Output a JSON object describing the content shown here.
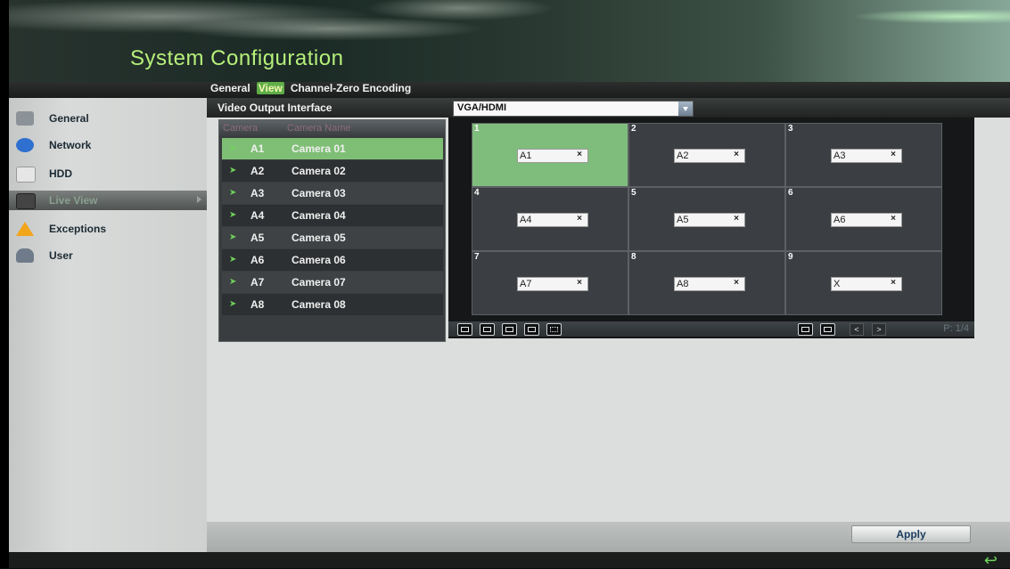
{
  "header": {
    "title": "System Configuration"
  },
  "tabs": [
    {
      "label": "General"
    },
    {
      "label": "View",
      "active": true
    },
    {
      "label": "Channel-Zero Encoding"
    }
  ],
  "sidebar": {
    "items": [
      {
        "label": "General",
        "icon": "gear-icon",
        "color": "#8c9398"
      },
      {
        "label": "Network",
        "icon": "globe-icon",
        "color": "#2f6fd0"
      },
      {
        "label": "HDD",
        "icon": "hdd-icon",
        "color": "#e6e6e6"
      },
      {
        "label": "Live View",
        "icon": "monitor-icon",
        "color": "#444444",
        "active": true
      },
      {
        "label": "Exceptions",
        "icon": "warning-icon",
        "color": "#f2a51a"
      },
      {
        "label": "User",
        "icon": "user-icon",
        "color": "#6f7b8a"
      }
    ]
  },
  "video_output": {
    "label": "Video Output Interface",
    "value": "VGA/HDMI"
  },
  "camera_list": {
    "headers": {
      "camera": "Camera",
      "name": "Camera Name"
    },
    "rows": [
      {
        "no": "A1",
        "name": "Camera 01",
        "selected": true
      },
      {
        "no": "A2",
        "name": "Camera 02"
      },
      {
        "no": "A3",
        "name": "Camera 03"
      },
      {
        "no": "A4",
        "name": "Camera 04"
      },
      {
        "no": "A5",
        "name": "Camera 05"
      },
      {
        "no": "A6",
        "name": "Camera 06"
      },
      {
        "no": "A7",
        "name": "Camera 07"
      },
      {
        "no": "A8",
        "name": "Camera 08"
      }
    ]
  },
  "preview": {
    "panes": [
      {
        "num": "1",
        "tag": "A1",
        "selected": true
      },
      {
        "num": "2",
        "tag": "A2"
      },
      {
        "num": "3",
        "tag": "A3"
      },
      {
        "num": "4",
        "tag": "A4"
      },
      {
        "num": "5",
        "tag": "A5"
      },
      {
        "num": "6",
        "tag": "A6"
      },
      {
        "num": "7",
        "tag": "A7"
      },
      {
        "num": "8",
        "tag": "A8"
      },
      {
        "num": "9",
        "tag": "X"
      }
    ],
    "close_glyph": "×",
    "page_indicator": "P: 1/4",
    "prev_glyph": "<",
    "next_glyph": ">"
  },
  "footer": {
    "apply_label": "Apply",
    "back_glyph": "↩"
  },
  "colors": {
    "accent_green": "#7fbf75",
    "title_green": "#b6f07a"
  }
}
